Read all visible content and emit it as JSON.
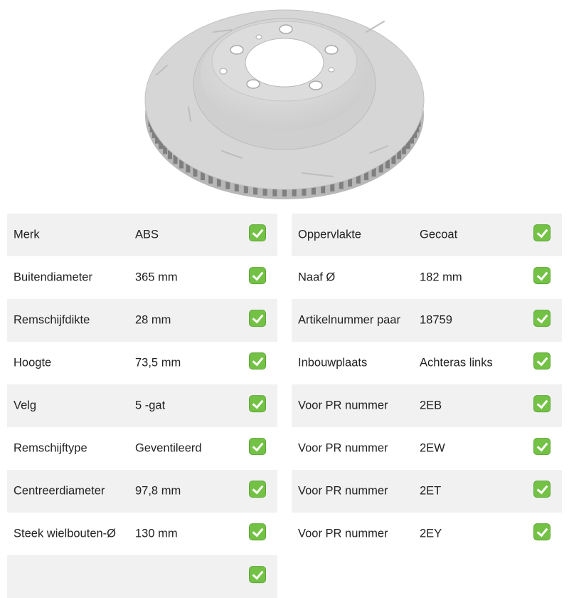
{
  "product": {
    "image_icon": "brake-disc-image"
  },
  "check_color": "#73c245",
  "specs_left": [
    {
      "label": "Merk",
      "value": "ABS"
    },
    {
      "label": "Buitendiameter",
      "value": "365 mm"
    },
    {
      "label": "Remschijfdikte",
      "value": "28 mm"
    },
    {
      "label": "Hoogte",
      "value": "73,5 mm"
    },
    {
      "label": "Velg",
      "value": "5 -gat"
    },
    {
      "label": "Remschijftype",
      "value": "Geventileerd"
    },
    {
      "label": "Centreerdiameter",
      "value": "97,8 mm"
    },
    {
      "label": "Steek wielbouten-Ø",
      "value": "130 mm"
    },
    {
      "label": "",
      "value": ""
    }
  ],
  "specs_right": [
    {
      "label": "Oppervlakte",
      "value": "Gecoat"
    },
    {
      "label": "Naaf Ø",
      "value": "182 mm"
    },
    {
      "label": "Artikelnummer paar",
      "value": "18759"
    },
    {
      "label": "Inbouwplaats",
      "value": "Achteras links"
    },
    {
      "label": "Voor PR nummer",
      "value": "2EB"
    },
    {
      "label": "Voor PR nummer",
      "value": "2EW"
    },
    {
      "label": "Voor PR nummer",
      "value": "2ET"
    },
    {
      "label": "Voor PR nummer",
      "value": "2EY"
    }
  ]
}
